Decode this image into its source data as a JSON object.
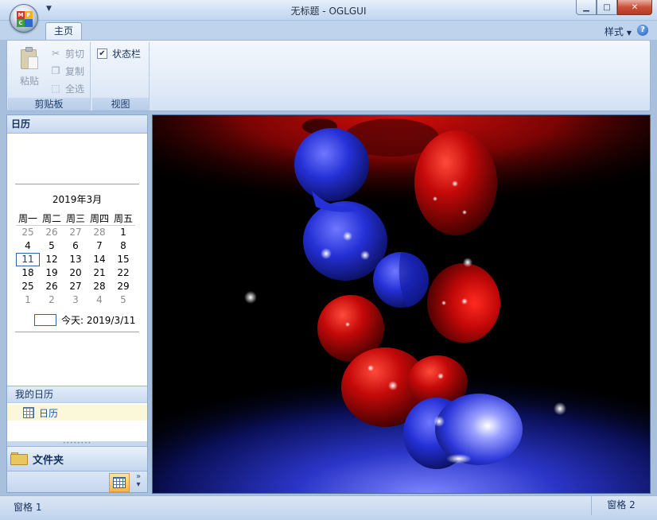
{
  "window": {
    "title": "无标题 - OGLGUI",
    "min": "0",
    "max": "1",
    "close": "r"
  },
  "app_button": {
    "icon": "mfc-app-icon",
    "letters": [
      "M",
      "F",
      "C",
      ""
    ]
  },
  "ribbon": {
    "tabs": [
      {
        "label": "主页"
      }
    ],
    "style_menu": "样式",
    "groups": {
      "clipboard": {
        "label": "剪贴板",
        "paste": "粘贴",
        "cut": "剪切",
        "copy": "复制",
        "select_all": "全选"
      },
      "view": {
        "label": "视图",
        "statusbar": "状态栏",
        "statusbar_checked": true
      }
    }
  },
  "left_pane": {
    "header": "日历",
    "calendar": {
      "month_title": "2019年3月",
      "weekdays": [
        "周一",
        "周二",
        "周三",
        "周四",
        "周五"
      ],
      "weeks": [
        [
          {
            "d": "25",
            "dim": true
          },
          {
            "d": "26",
            "dim": true
          },
          {
            "d": "27",
            "dim": true
          },
          {
            "d": "28",
            "dim": true
          },
          {
            "d": "1"
          }
        ],
        [
          {
            "d": "4"
          },
          {
            "d": "5"
          },
          {
            "d": "6"
          },
          {
            "d": "7"
          },
          {
            "d": "8"
          }
        ],
        [
          {
            "d": "11",
            "today": true
          },
          {
            "d": "12"
          },
          {
            "d": "13"
          },
          {
            "d": "14"
          },
          {
            "d": "15"
          }
        ],
        [
          {
            "d": "18"
          },
          {
            "d": "19"
          },
          {
            "d": "20"
          },
          {
            "d": "21"
          },
          {
            "d": "22"
          }
        ],
        [
          {
            "d": "25"
          },
          {
            "d": "26"
          },
          {
            "d": "27"
          },
          {
            "d": "28"
          },
          {
            "d": "29"
          }
        ],
        [
          {
            "d": "1",
            "dim": true
          },
          {
            "d": "2",
            "dim": true
          },
          {
            "d": "3",
            "dim": true
          },
          {
            "d": "4",
            "dim": true
          },
          {
            "d": "5",
            "dim": true
          }
        ]
      ],
      "today_label": "今天: 2019/3/11"
    },
    "my_calendars_header": "我的日历",
    "my_calendars": [
      {
        "label": "日历"
      }
    ],
    "folders_button": "文件夹"
  },
  "statusbar": {
    "pane1": "窗格 1",
    "pane2": "窗格 2"
  },
  "colors": {
    "accent": "#c1d6ef",
    "red_blob": "#c4090a",
    "blue_blob": "#2a38e0"
  }
}
